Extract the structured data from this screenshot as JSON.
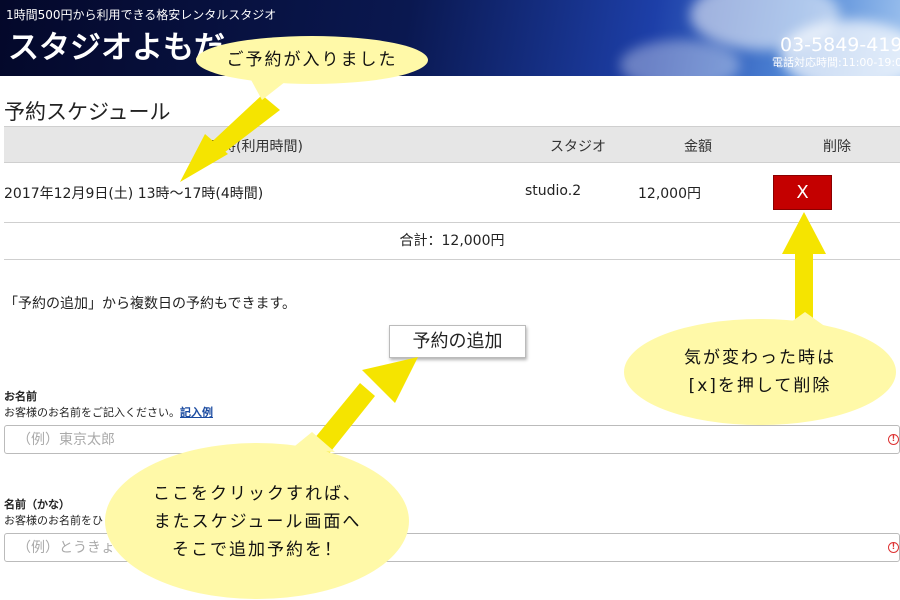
{
  "header": {
    "tagline": "1時間500円から利用できる格安レンタルスタジオ",
    "site_name": "スタジオよもだ",
    "phone": "03-5849-419",
    "hours": "電話対応時間:11:00-19:0"
  },
  "schedule": {
    "title": "予約スケジュール",
    "columns": [
      "日時(利用時間)",
      "スタジオ",
      "金額",
      "削除"
    ],
    "rows": [
      {
        "datetime": "2017年12月9日(土) 13時～17時(4時間)",
        "studio": "studio.2",
        "amount": "12,000円",
        "delete_label": "X"
      }
    ],
    "total": "合計：12,000円"
  },
  "add": {
    "note": "「予約の追加」から複数日の予約もできます。",
    "button_label": "予約の追加"
  },
  "form": {
    "name": {
      "label": "お名前",
      "description": "お客様のお名前をご記入ください。",
      "example_link": "記入例",
      "placeholder": "（例）東京太郎"
    },
    "kana": {
      "label": "名前（かな）",
      "description": "お客様のお名前をひ",
      "placeholder": "（例）とうきょうた"
    },
    "alert_glyph": "!"
  },
  "annotations": {
    "bubble1": "ご予約が入りました",
    "bubble2_line1": "気が変わった時は",
    "bubble2_line2": "[x]を押して削除",
    "bubble3_line1": "ここをクリックすれば、",
    "bubble3_line2": "またスケジュール画面へ",
    "bubble3_line3": "そこで追加予約を！"
  },
  "colors": {
    "delete_button": "#c40000",
    "bubble": "#fff9a8",
    "arrow": "#f5e400",
    "header_dark": "#04082a"
  }
}
